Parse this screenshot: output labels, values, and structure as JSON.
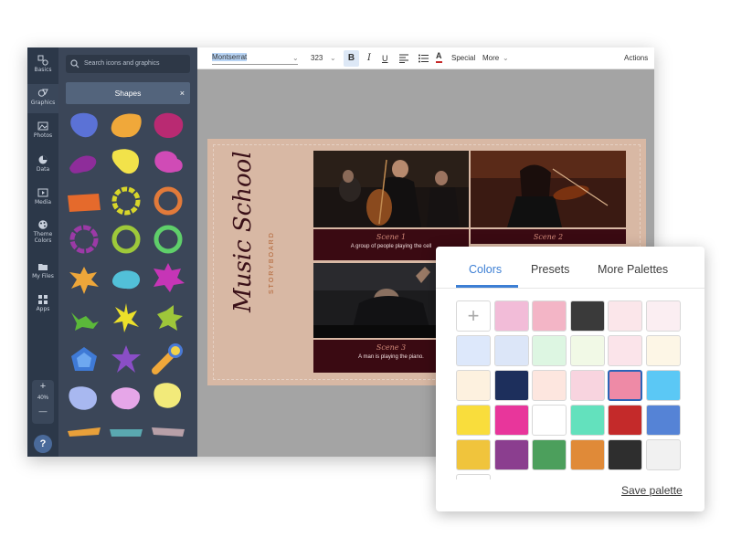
{
  "rail": {
    "items": [
      {
        "label": "Basics",
        "icon": "basics-icon"
      },
      {
        "label": "Graphics",
        "icon": "graphics-icon"
      },
      {
        "label": "Photos",
        "icon": "photos-icon"
      },
      {
        "label": "Data",
        "icon": "data-icon"
      },
      {
        "label": "Media",
        "icon": "media-icon"
      },
      {
        "label": "Theme",
        "label2": "Colors",
        "icon": "palette-icon"
      },
      {
        "label": "My Files",
        "icon": "files-icon"
      },
      {
        "label": "Apps",
        "icon": "apps-icon"
      }
    ],
    "zoom": "40%",
    "zoom_plus": "+",
    "zoom_minus": "—",
    "help": "?"
  },
  "panel": {
    "search_placeholder": "Search icons and graphics",
    "section_title": "Shapes",
    "close": "×"
  },
  "toolbar": {
    "font": "Montserrat",
    "size": "323",
    "bold": "B",
    "italic": "I",
    "underline": "U",
    "text_color": "A",
    "special": "Special",
    "more": "More",
    "actions": "Actions"
  },
  "canvas": {
    "title": "Music School",
    "subtitle": "STORYBOARD",
    "scenes": [
      {
        "scene": "Scene 1",
        "text": "A group of people playing the cell"
      },
      {
        "scene": "Scene 2",
        "text": ""
      },
      {
        "scene": "Scene 3",
        "text": "A man is playing the piano."
      }
    ]
  },
  "palette": {
    "tabs": [
      "Colors",
      "Presets",
      "More Palettes"
    ],
    "add": "+",
    "swatches": [
      "#f2bcd8",
      "#f3b5c6",
      "#3a3a3a",
      "#fbe6ea",
      "#fbeef2",
      "#dde8fb",
      "#dce6f8",
      "#ddf6e2",
      "#f1f9e6",
      "#fbe4ea",
      "#fdf6e6",
      "#fdf1df",
      "#1d2f5c",
      "#fde6df",
      "#f8d4df",
      "#ee8aa6",
      "#5bc8f5",
      "#f9dd3c",
      "#e8369b",
      "#ffffff",
      "#63e1bd",
      "#c42a2a",
      "#5583d6",
      "#f0c43c",
      "#8b3e8f",
      "#4c9f5c",
      "#e08a38",
      "#2e2e2e",
      "#f1f1f1"
    ],
    "save": "Save palette"
  }
}
